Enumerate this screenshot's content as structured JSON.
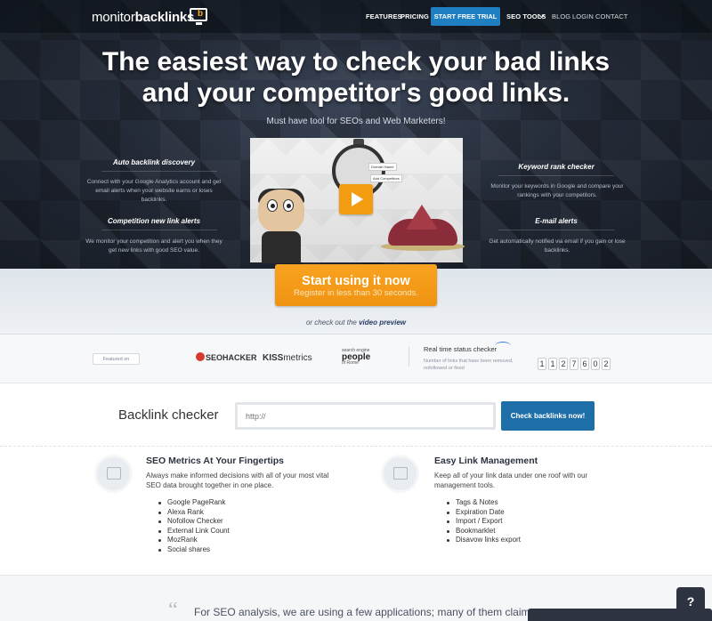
{
  "nav": {
    "logo_part1": "monitor",
    "logo_part2": "backlinks",
    "logo_mark": "b",
    "features": "FEATURES",
    "pricing": "PRICING",
    "trial": "START FREE TRIAL",
    "seo_tools": "SEO TOOLS",
    "blog": "BLOG",
    "login": "LOGIN",
    "contact": "CONTACT"
  },
  "hero": {
    "headline_line1": "The easiest way to check your bad links",
    "headline_line2": "and your competitor's good links.",
    "subhead": "Must have tool for SEOs and Web Marketers!",
    "features_left": [
      {
        "title": "Auto backlink discovery",
        "text": "Connect with your Google Analytics account and get email alerts when your website earns or loses backlinks."
      },
      {
        "title": "Competition new link alerts",
        "text": "We monitor your competition and alert you when they get new links with good SEO value."
      }
    ],
    "features_right": [
      {
        "title": "Keyword rank checker",
        "text": "Monitor your keywords in Google and compare your rankings with your competitors."
      },
      {
        "title": "E-mail alerts",
        "text": "Get automatically notified via email if you gain or lose backlinks."
      }
    ],
    "video_tag1": "Domain Name",
    "video_tag2": "Add Competitors"
  },
  "cta": {
    "main": "Start using it now",
    "sub": "Register in less than 30 seconds.",
    "check_out_prefix": "or check out the ",
    "check_out_link": "video preview"
  },
  "featured": {
    "label": "Featured on",
    "logo1": "SEOHACKER",
    "logo2_a": "KISS",
    "logo2_b": "metrics",
    "logo3_top": "search engine",
    "logo3_main": "people",
    "logo3_bottom": "of Rome",
    "rts_title": "Real time status checker",
    "rts_desc": "Number of links that have been removed, nofollowed or fixed",
    "counter": [
      "1",
      "1",
      "2",
      "7",
      "6",
      "0",
      "2"
    ]
  },
  "checker": {
    "title": "Backlink checker",
    "placeholder": "http://",
    "button": "Check backlinks now!"
  },
  "blocks": [
    {
      "title": "SEO Metrics At Your Fingertips",
      "desc": "Always make informed decisions with all of your most vital SEO data brought together in one place.",
      "items": [
        "Google PageRank",
        "Alexa Rank",
        "Nofollow Checker",
        "External Link Count",
        "MozRank",
        "Social shares"
      ]
    },
    {
      "title": "Easy Link Management",
      "desc": "Keep all of your link data under one roof with our management tools.",
      "items": [
        "Tags & Notes",
        "Expiration Date",
        "Import / Export",
        "Bookmarklet",
        "Disavow links export"
      ]
    }
  ],
  "testimonial": {
    "quote_mark": "“",
    "text": "For SEO analysis, we are using a few applications; many of them claim"
  },
  "chat": {
    "label": "?"
  },
  "colors": {
    "accent_blue": "#1f7fc0",
    "cta_orange": "#f39c12",
    "hero_dark": "#242b38"
  }
}
